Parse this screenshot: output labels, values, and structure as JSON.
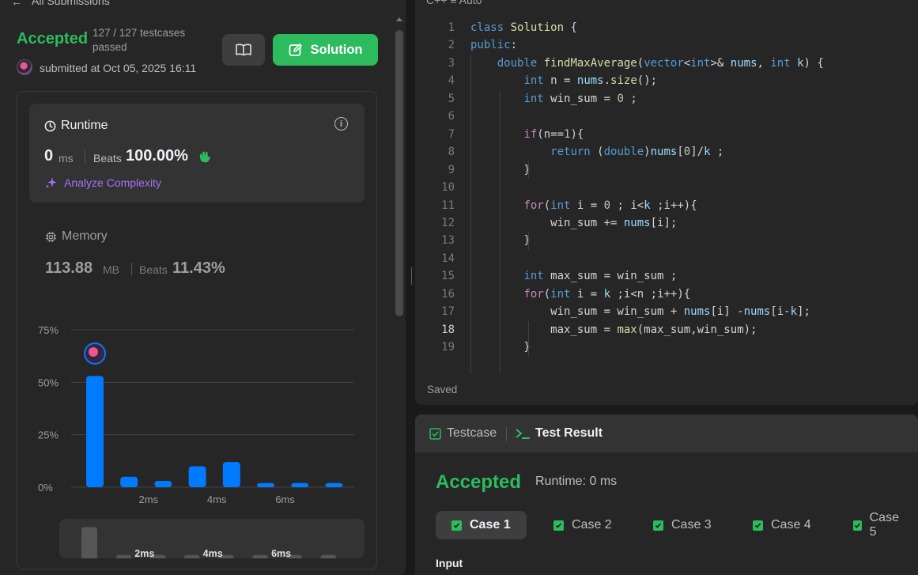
{
  "header": {
    "back_glyph": "←",
    "title": "All Submissions"
  },
  "submission": {
    "status": "Accepted",
    "testcases": "127 / 127 testcases passed",
    "submitted_at": "submitted at Oct 05, 2025 16:11",
    "solution_label": "Solution"
  },
  "runtime": {
    "title": "Runtime",
    "value": "0",
    "unit": "ms",
    "beats_label": "Beats",
    "beats_value": "100.00%",
    "analyze_label": "Analyze Complexity"
  },
  "memory": {
    "title": "Memory",
    "value": "113.88",
    "unit": "MB",
    "beats_label": "Beats",
    "beats_value": "11.43%"
  },
  "chart_data": {
    "type": "bar",
    "categories": [
      "0ms",
      "1ms",
      "2ms",
      "3ms",
      "4ms",
      "5ms",
      "6ms",
      "7ms"
    ],
    "values": [
      53,
      5,
      3,
      10,
      12,
      2,
      2,
      2
    ],
    "yticks": [
      "75%",
      "50%",
      "25%",
      "0%"
    ],
    "ylim": [
      0,
      75
    ],
    "xticks": [
      "2ms",
      "4ms",
      "6ms"
    ],
    "bar_color": "#007aff",
    "highlight_index": 0
  },
  "mini_chart": {
    "values": [
      90,
      10,
      10,
      10,
      10,
      10,
      10,
      10
    ],
    "labels": [
      "2ms",
      "4ms",
      "6ms"
    ]
  },
  "editor": {
    "top_label": "C++     ≡ Auto",
    "saved_label": "Saved",
    "current_line": 18,
    "lines": [
      "class Solution {",
      "public:",
      "    double findMaxAverage(vector<int>& nums, int k) {",
      "        int n = nums.size();",
      "        int win_sum = 0 ;",
      "",
      "        if(n==1){",
      "            return (double)nums[0]/k ;",
      "        }",
      "",
      "        for(int i = 0 ; i<k ;i++){",
      "            win_sum += nums[i];",
      "        }",
      "",
      "        int max_sum = win_sum ;",
      "        for(int i = k ;i<n ;i++){",
      "            win_sum = win_sum + nums[i] -nums[i-k];",
      "            max_sum = max(max_sum,win_sum);",
      "        }"
    ]
  },
  "testpanel": {
    "tab_testcase": "Testcase",
    "tab_result": "Test Result",
    "status": "Accepted",
    "runtime": "Runtime: 0 ms",
    "cases": [
      "Case 1",
      "Case 2",
      "Case 3",
      "Case 4",
      "Case 5"
    ],
    "input_label": "Input"
  },
  "colors": {
    "accent_green": "#2cbb5d",
    "bar_blue": "#007aff",
    "purple": "#a371f7"
  }
}
